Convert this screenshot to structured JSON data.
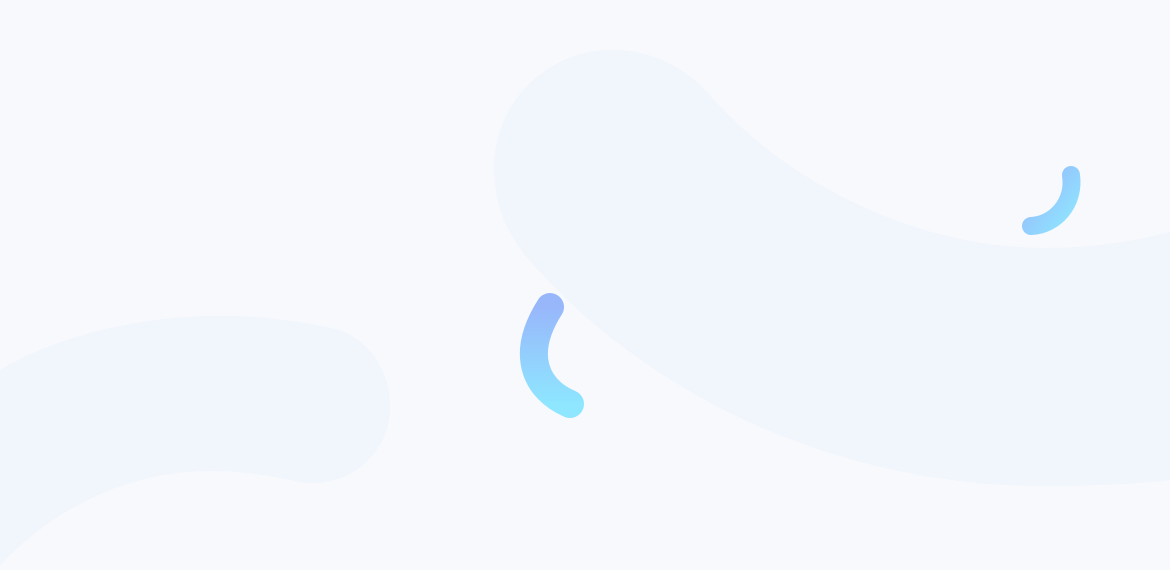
{
  "colors": {
    "background": "#f7f9fd",
    "blob": "#f1f5fc",
    "arc_gradient_start": "#98b7fb",
    "arc_gradient_end": "#8ee6ff"
  }
}
